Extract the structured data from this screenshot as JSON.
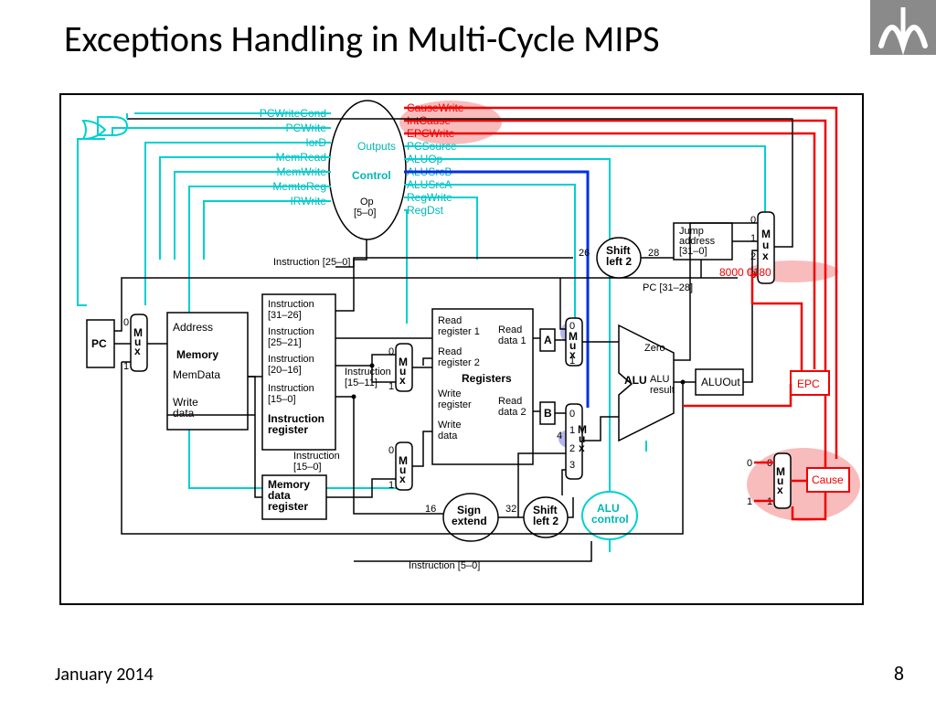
{
  "title": "Exceptions Handling in Multi-Cycle MIPS",
  "footer_date": "January  2014",
  "page_number": "8",
  "diagram": {
    "control": {
      "label": "Control",
      "outputs": "Outputs",
      "opfield": "Op\n[5–0]"
    },
    "control_signals_left": {
      "pcwritecond": "PCWriteCond",
      "pcwrite": "PCWrite",
      "iord": "IorD",
      "memread": "MemRead",
      "memwrite": "MemWrite",
      "memtoreg": "MemtoReg",
      "irwrite": "IRWrite"
    },
    "control_signals_right": {
      "causewrite": "CauseWrite",
      "intcause": "IntCause",
      "epcwrite": "EPCWrite",
      "pcsource": "PCSource",
      "aluop": "ALUOp",
      "alusrcb": "ALUSrcB",
      "alusrca": "ALUSrcA",
      "regwrite": "RegWrite",
      "regdst": "RegDst"
    },
    "pc": "PC",
    "mux": "Mux",
    "memory": {
      "label": "Memory",
      "address": "Address",
      "memdata": "MemData",
      "writedata": "Write\ndata"
    },
    "ir": {
      "i31_26": "Instruction\n[31–26]",
      "i25_21": "Instruction\n[25–21]",
      "i20_16": "Instruction\n[20–16]",
      "i15_0": "Instruction\n[15–0]",
      "label": "Instruction\nregister",
      "i15_11": "Instruction\n[15–11]",
      "i15_0b": "Instruction\n[15–0]",
      "i25_0": "Instruction [25–0]",
      "i5_0": "Instruction [5–0]"
    },
    "mdr": "Memory\ndata\nregister",
    "registers": {
      "label": "Registers",
      "r1": "Read\nregister 1",
      "r2": "Read\nregister 2",
      "wr": "Write\nregister",
      "wd": "Write\ndata",
      "d1": "Read\ndata 1",
      "d2": "Read\ndata 2"
    },
    "A": "A",
    "B": "B",
    "four": "4",
    "signext": "Sign\nextend",
    "sl2_a": "Shift\nleft 2",
    "sl2_b": "Shift\nleft 2",
    "w16": "16",
    "w32": "32",
    "w26": "26",
    "w28": "28",
    "alu": {
      "label": "ALU",
      "zero": "Zero",
      "result": "ALU\nresult"
    },
    "aluout": "ALUOut",
    "alucontrol": "ALU\ncontrol",
    "jump": "Jump\naddress\n[31–0]",
    "pc31_28": "PC [31–28]",
    "excaddr": "8000 0180",
    "epc": "EPC",
    "cause": "Cause",
    "ports": {
      "p0": "0",
      "p1": "1",
      "p2": "2",
      "p3": "3"
    }
  }
}
